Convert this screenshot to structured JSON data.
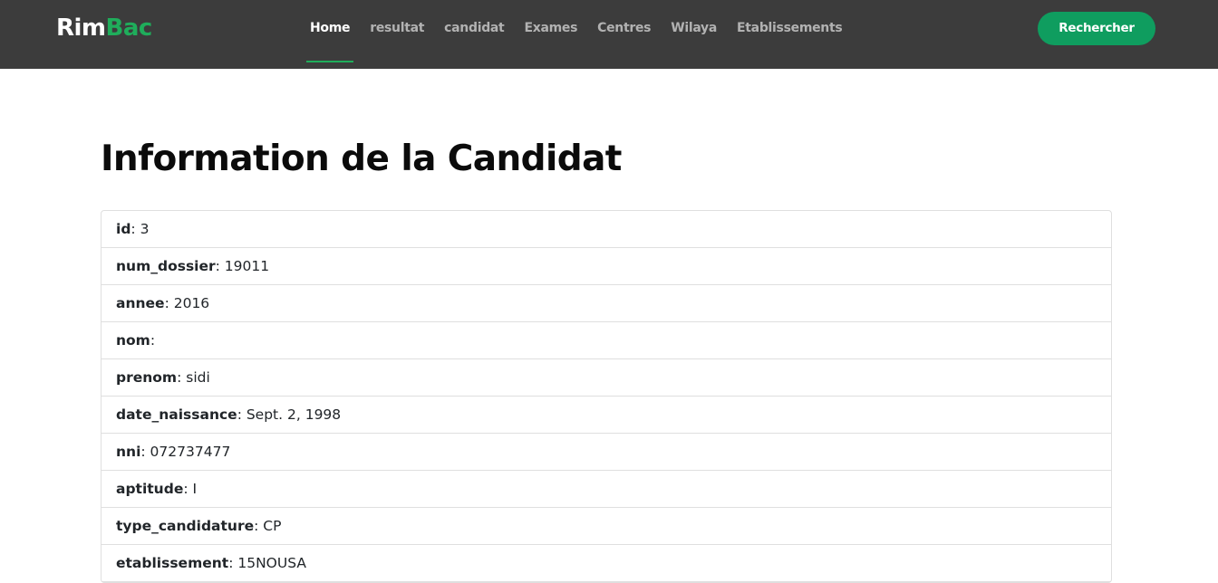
{
  "brand": {
    "part1": "Rim",
    "part2": "Bac"
  },
  "nav": {
    "items": [
      {
        "label": "Home",
        "active": true
      },
      {
        "label": "resultat"
      },
      {
        "label": "candidat"
      },
      {
        "label": "Exames"
      },
      {
        "label": "Centres"
      },
      {
        "label": "Wilaya"
      },
      {
        "label": "Etablissements"
      }
    ],
    "search_label": "Rechercher"
  },
  "page": {
    "title": "Information de la Candidat"
  },
  "candidate": {
    "fields": [
      {
        "key": "id",
        "value": "3"
      },
      {
        "key": "num_dossier",
        "value": "19011"
      },
      {
        "key": "annee",
        "value": "2016"
      },
      {
        "key": "nom",
        "value": ""
      },
      {
        "key": "prenom",
        "value": "sidi"
      },
      {
        "key": "date_naissance",
        "value": "Sept. 2, 1998"
      },
      {
        "key": "nni",
        "value": "072737477"
      },
      {
        "key": "aptitude",
        "value": "I"
      },
      {
        "key": "type_candidature",
        "value": "CP"
      },
      {
        "key": "etablissement",
        "value": "15NOUSA"
      }
    ]
  },
  "colors": {
    "navbar_bg": "#3c3c3c",
    "accent": "#1fad5b",
    "button_bg": "#0f9d5f"
  }
}
